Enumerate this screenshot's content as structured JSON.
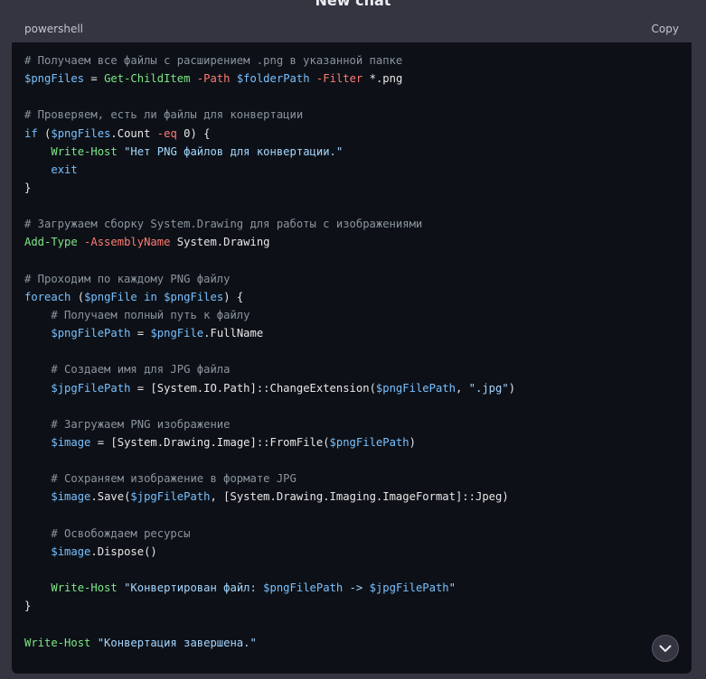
{
  "page": {
    "title": "New chat"
  },
  "code_block": {
    "language": "powershell",
    "copy_label": "Copy",
    "lines": [
      "# Получаем все файлы с расширением .png в указанной папке",
      "$pngFiles = Get-ChildItem -Path $folderPath -Filter *.png",
      "",
      "# Проверяем, есть ли файлы для конвертации",
      "if ($pngFiles.Count -eq 0) {",
      "    Write-Host \"Нет PNG файлов для конвертации.\"",
      "    exit",
      "}",
      "",
      "# Загружаем сборку System.Drawing для работы с изображениями",
      "Add-Type -AssemblyName System.Drawing",
      "",
      "# Проходим по каждому PNG файлу",
      "foreach ($pngFile in $pngFiles) {",
      "    # Получаем полный путь к файлу",
      "    $pngFilePath = $pngFile.FullName",
      "",
      "    # Создаем имя для JPG файла",
      "    $jpgFilePath = [System.IO.Path]::ChangeExtension($pngFilePath, \".jpg\")",
      "",
      "    # Загружаем PNG изображение",
      "    $image = [System.Drawing.Image]::FromFile($pngFilePath)",
      "",
      "    # Сохраняем изображение в формате JPG",
      "    $image.Save($jpgFilePath, [System.Drawing.Imaging.ImageFormat]::Jpeg)",
      "",
      "    # Освобождаем ресурсы",
      "    $image.Dispose()",
      "",
      "    Write-Host \"Конвертирован файл: $pngFilePath -> $jpgFilePath\"",
      "}",
      "",
      "Write-Host \"Конвертация завершена.\""
    ]
  },
  "scroll_button": {
    "icon": "chevron-down-icon"
  },
  "colors": {
    "background": "#343541",
    "code_background": "#0d1117",
    "comment": "#8b949e",
    "variable": "#79c0ff",
    "cmdlet": "#7ee787",
    "string": "#a5d6ff",
    "operator": "#ff7b72"
  }
}
